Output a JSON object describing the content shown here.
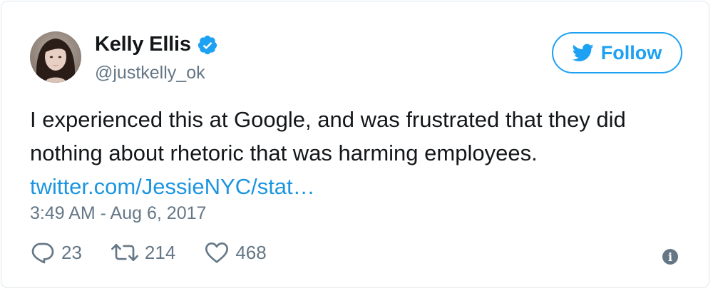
{
  "user": {
    "name": "Kelly Ellis",
    "handle": "@justkelly_ok",
    "verified": true,
    "avatar_icon": "user-avatar-photo"
  },
  "follow_button": {
    "label": "Follow",
    "icon": "twitter-bird-icon",
    "color": "#1da1f2"
  },
  "tweet": {
    "text_line_1": "I experienced this at Google, and was frustrated that they did",
    "text_line_2": "nothing about rhetoric that was harming employees.",
    "link_text": "twitter.com/JessieNYC/stat…",
    "timestamp": "3:49 AM - Aug 6, 2017"
  },
  "actions": {
    "reply_count": "23",
    "retweet_count": "214",
    "like_count": "468",
    "info_glyph": "i"
  },
  "colors": {
    "text": "#14171a",
    "secondary": "#657786",
    "link": "#1b95e0",
    "border": "#e1e8ed"
  }
}
